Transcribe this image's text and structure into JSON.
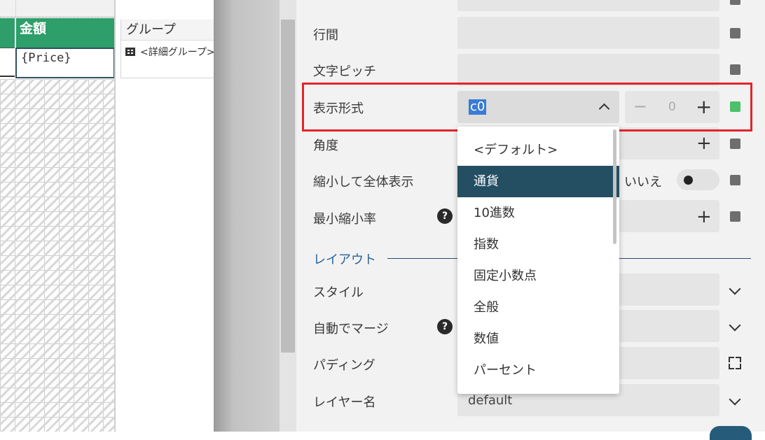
{
  "canvas": {
    "column_header": "金額",
    "field": "{Price}"
  },
  "group_panel": {
    "title": "グループ",
    "item": "<詳細グループ>"
  },
  "properties": {
    "rows": {
      "line_spacing": "行間",
      "char_pitch": "文字ピッチ",
      "display_format": "表示形式",
      "angle": "角度",
      "shrink_to_fit": "縮小して全体表示",
      "min_scale": "最小縮小率"
    },
    "format_value": "c0",
    "stepper_value": "0",
    "shrink_toggle_label": "いいえ",
    "help_glyph": "?",
    "layout_section": "レイアウト",
    "layout_rows": {
      "style": "スタイル",
      "auto_merge": "自動でマージ",
      "padding": "パディング",
      "layer_name": "レイヤー名"
    },
    "layer_value": "default",
    "status_colors": {
      "active": "#4cc06a",
      "inactive": "#6e6e6e"
    }
  },
  "dropdown": {
    "options": [
      "<デフォルト>",
      "通貨",
      "10進数",
      "指数",
      "固定小数点",
      "全般",
      "数値",
      "パーセント"
    ],
    "selected_index": 1
  },
  "colors": {
    "header_green": "#2e9e6a",
    "selected_option": "#244f63",
    "highlight_border": "#e3242b",
    "section_title": "#2a6496"
  }
}
